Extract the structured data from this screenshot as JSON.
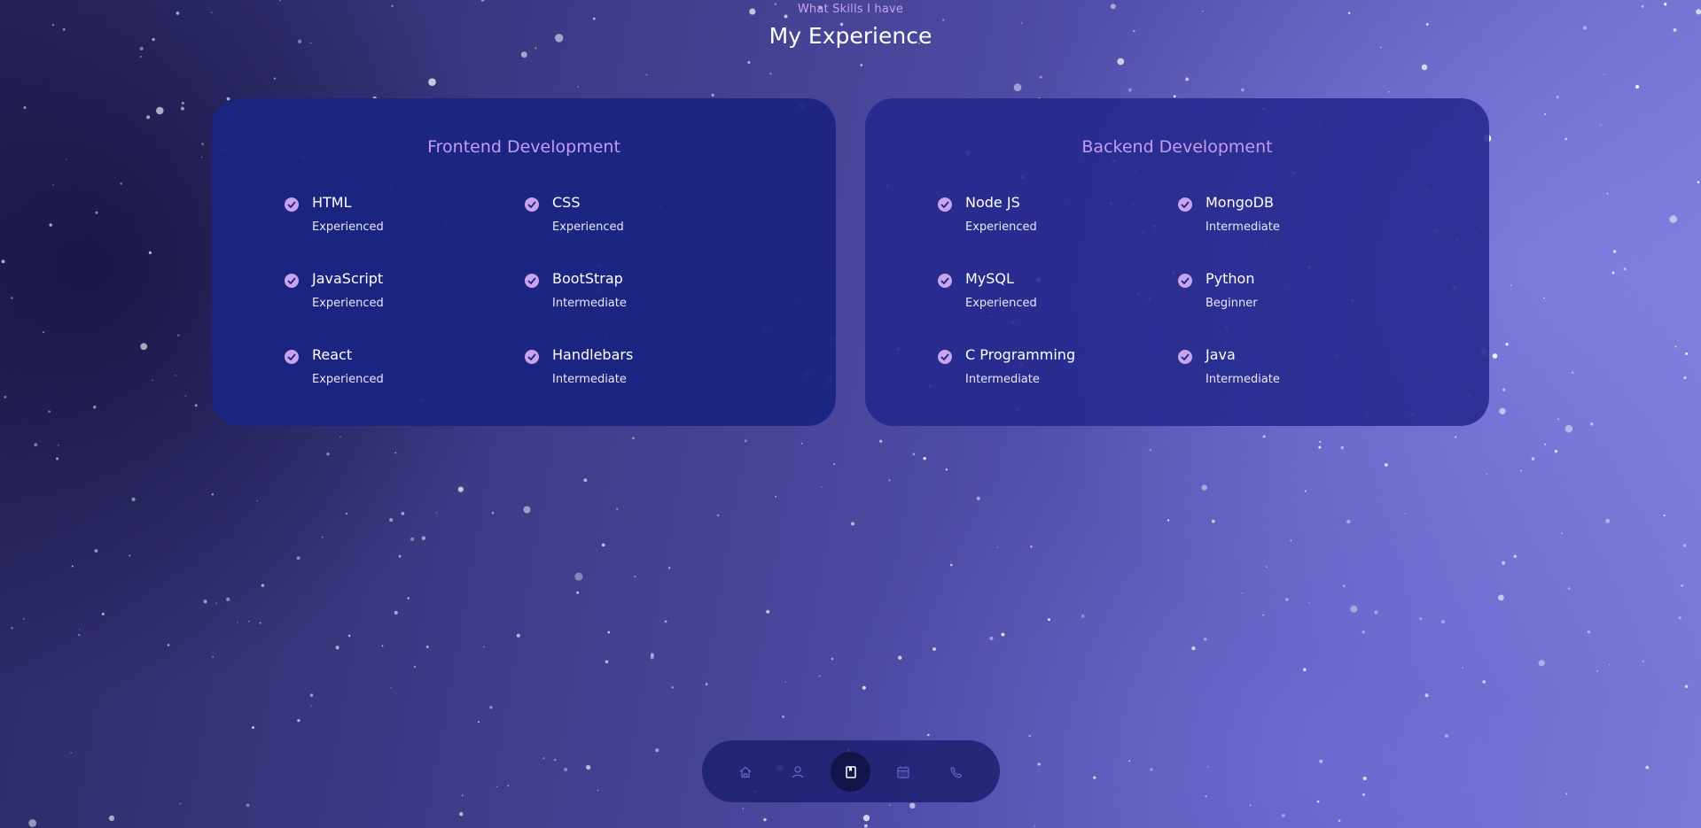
{
  "header": {
    "subtitle": "What Skills I have",
    "title": "My Experience"
  },
  "frontend": {
    "title": "Frontend Development",
    "skills": [
      {
        "name": "HTML",
        "level": "Experienced"
      },
      {
        "name": "CSS",
        "level": "Experienced"
      },
      {
        "name": "JavaScript",
        "level": "Experienced"
      },
      {
        "name": "BootStrap",
        "level": "Intermediate"
      },
      {
        "name": "React",
        "level": "Experienced"
      },
      {
        "name": "Handlebars",
        "level": "Intermediate"
      }
    ]
  },
  "backend": {
    "title": "Backend Development",
    "skills": [
      {
        "name": "Node JS",
        "level": "Experienced"
      },
      {
        "name": "MongoDB",
        "level": "Intermediate"
      },
      {
        "name": "MySQL",
        "level": "Experienced"
      },
      {
        "name": "Python",
        "level": "Beginner"
      },
      {
        "name": "C Programming",
        "level": "Intermediate"
      },
      {
        "name": "Java",
        "level": "Intermediate"
      }
    ]
  },
  "nav": {
    "items": [
      {
        "icon": "home-icon",
        "active": false
      },
      {
        "icon": "user-icon",
        "active": false
      },
      {
        "icon": "book-icon",
        "active": true
      },
      {
        "icon": "briefcase-icon",
        "active": false
      },
      {
        "icon": "phone-icon",
        "active": false
      }
    ]
  },
  "colors": {
    "accent": "#c9a3ee",
    "card": "#1c2482",
    "nav_active": "#13154a"
  }
}
